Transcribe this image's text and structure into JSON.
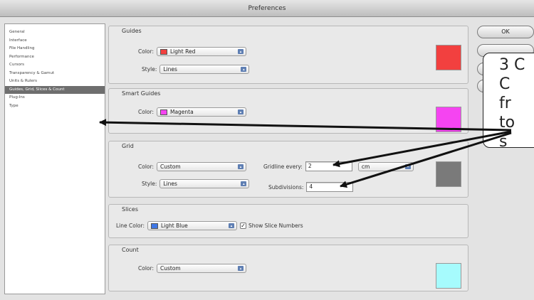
{
  "window": {
    "title": "Preferences"
  },
  "sidebar": {
    "items": [
      {
        "label": "General"
      },
      {
        "label": "Interface"
      },
      {
        "label": "File Handling"
      },
      {
        "label": "Performance"
      },
      {
        "label": "Cursors"
      },
      {
        "label": "Transparency & Gamut"
      },
      {
        "label": "Units & Rulers"
      },
      {
        "label": "Guides, Grid, Slices & Count"
      },
      {
        "label": "Plug-Ins"
      },
      {
        "label": "Type"
      }
    ],
    "selected_index": 7
  },
  "guides": {
    "title": "Guides",
    "color_label": "Color:",
    "color_value": "Light Red",
    "color_hex": "#f2403f",
    "style_label": "Style:",
    "style_value": "Lines"
  },
  "smart_guides": {
    "title": "Smart Guides",
    "color_label": "Color:",
    "color_value": "Magenta",
    "color_hex": "#f544f1"
  },
  "grid": {
    "title": "Grid",
    "color_label": "Color:",
    "color_value": "Custom",
    "color_hex": "#7a7a7a",
    "style_label": "Style:",
    "style_value": "Lines",
    "gridline_label": "Gridline every:",
    "gridline_value": "2",
    "unit_value": "cm",
    "subdivisions_label": "Subdivisions:",
    "subdivisions_value": "4"
  },
  "slices": {
    "title": "Slices",
    "line_color_label": "Line Color:",
    "line_color_value": "Light Blue",
    "line_color_hex": "#3f78e6",
    "show_numbers_label": "Show Slice Numbers",
    "show_numbers_checked": true
  },
  "count": {
    "title": "Count",
    "color_label": "Color:",
    "color_value": "Custom",
    "color_hex": "#a6fbfd"
  },
  "buttons": {
    "ok": "OK"
  },
  "callout": {
    "lines": [
      "3 C",
      "C",
      "fr",
      "to",
      "s"
    ]
  }
}
